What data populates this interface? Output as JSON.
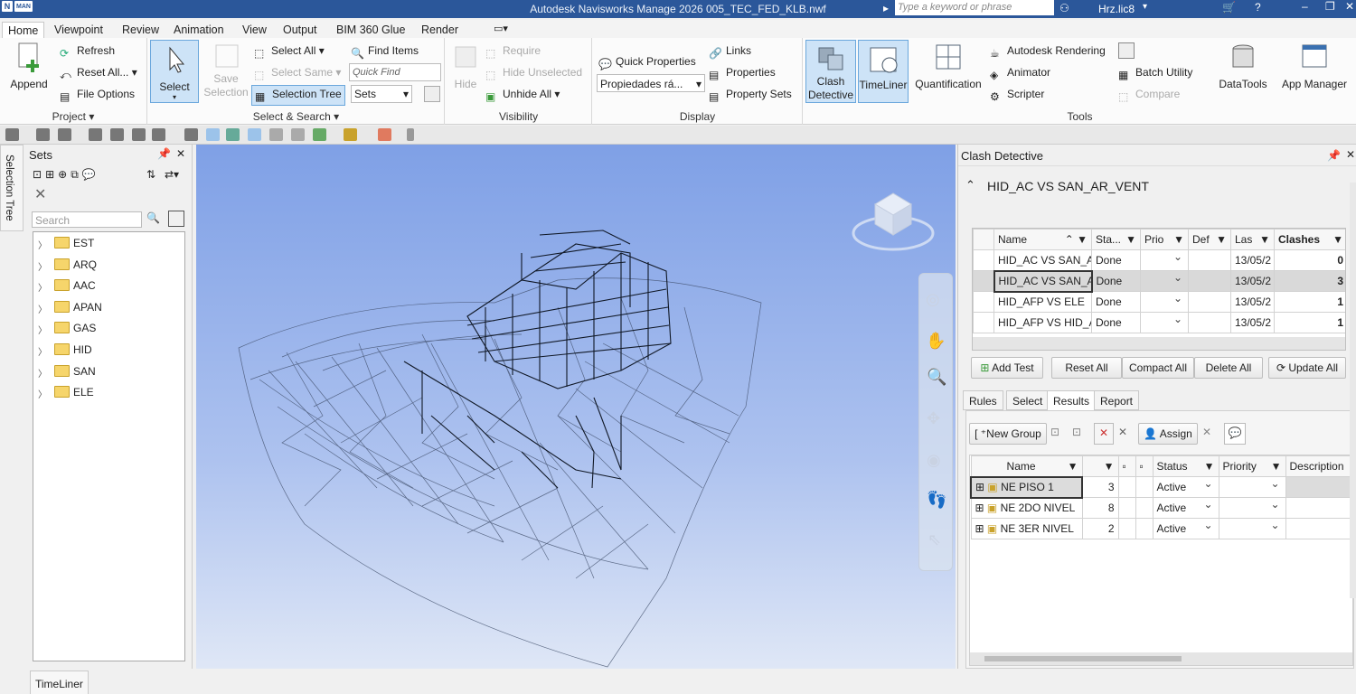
{
  "window": {
    "title": "Autodesk Navisworks Manage 2026    005_TEC_FED_KLB.nwf",
    "logo": [
      "N",
      "MAN"
    ],
    "search_placeholder": "Type a keyword or phrase",
    "user": "Hrz.lic8"
  },
  "tabs": [
    "Home",
    "Viewpoint",
    "Review",
    "Animation",
    "View",
    "Output",
    "BIM 360 Glue",
    "Render"
  ],
  "ribbon": {
    "project": {
      "label": "Project",
      "append": "Append",
      "refresh": "Refresh",
      "reset_all": "Reset All...",
      "file_options": "File Options"
    },
    "select_search": {
      "label": "Select & Search",
      "select": "Select",
      "save_selection": "Save Selection",
      "select_all": "Select All",
      "select_same": "Select Same",
      "selection_tree": "Selection Tree",
      "find_items": "Find Items",
      "quick_find_placeholder": "Quick Find",
      "sets": "Sets"
    },
    "visibility": {
      "label": "Visibility",
      "hide": "Hide",
      "require": "Require",
      "hide_unselected": "Hide Unselected",
      "unhide_all": "Unhide All"
    },
    "display": {
      "label": "Display",
      "quick_properties": "Quick Properties",
      "propiedades": "Propiedades rá...",
      "links": "Links",
      "properties": "Properties",
      "property_sets": "Property Sets"
    },
    "tools": {
      "label": "Tools",
      "clash_detective": "Clash Detective",
      "timeliner": "TimeLiner",
      "quantification": "Quantification",
      "autodesk_rendering": "Autodesk Rendering",
      "animator": "Animator",
      "scripter": "Scripter",
      "batch_utility": "Batch Utility",
      "compare": "Compare",
      "datatools": "DataTools",
      "app_manager": "App Manager"
    }
  },
  "selection_tree_tab": "Selection Tree",
  "sets_panel": {
    "title": "Sets",
    "search_placeholder": "Search",
    "folders": [
      "EST",
      "ARQ",
      "AAC",
      "APAN",
      "GAS",
      "HID",
      "SAN",
      "ELE"
    ]
  },
  "clash": {
    "title": "Clash Detective",
    "current_test": "HID_AC VS SAN_AR_VENT",
    "tests_columns": [
      "Name",
      "Sta...",
      "Prio",
      "Def",
      "Las",
      "Clashes"
    ],
    "tests": [
      {
        "name": "HID_AC VS SAN_AI",
        "status": "Done",
        "last": "13/05/2",
        "clashes": "0"
      },
      {
        "name": "HID_AC VS SAN_AI",
        "status": "Done",
        "last": "13/05/2",
        "clashes": "3"
      },
      {
        "name": "HID_AFP VS ELE",
        "status": "Done",
        "last": "13/05/2",
        "clashes": "1"
      },
      {
        "name": "HID_AFP VS HID_A",
        "status": "Done",
        "last": "13/05/2",
        "clashes": "1"
      }
    ],
    "buttons": {
      "add_test": "Add Test",
      "reset_all": "Reset All",
      "compact_all": "Compact All",
      "delete_all": "Delete All",
      "update_all": "Update All"
    },
    "subtabs": [
      "Rules",
      "Select",
      "Results",
      "Report"
    ],
    "results_toolbar": {
      "new_group": "New Group",
      "assign": "Assign"
    },
    "results_columns": [
      "Name",
      "Status",
      "Priority",
      "Description"
    ],
    "results": [
      {
        "name": "NE PISO 1",
        "count": "3",
        "status": "Active"
      },
      {
        "name": "NE 2DO NIVEL",
        "count": "8",
        "status": "Active"
      },
      {
        "name": "NE 3ER NIVEL",
        "count": "2",
        "status": "Active"
      }
    ]
  },
  "bottom_tab": "TimeLiner",
  "colors": {
    "title_bar": "#2b579a",
    "viewport_top": "#7fa0e6",
    "viewport_bottom": "#dfe7f6",
    "selected_button": "#cde3f7"
  }
}
